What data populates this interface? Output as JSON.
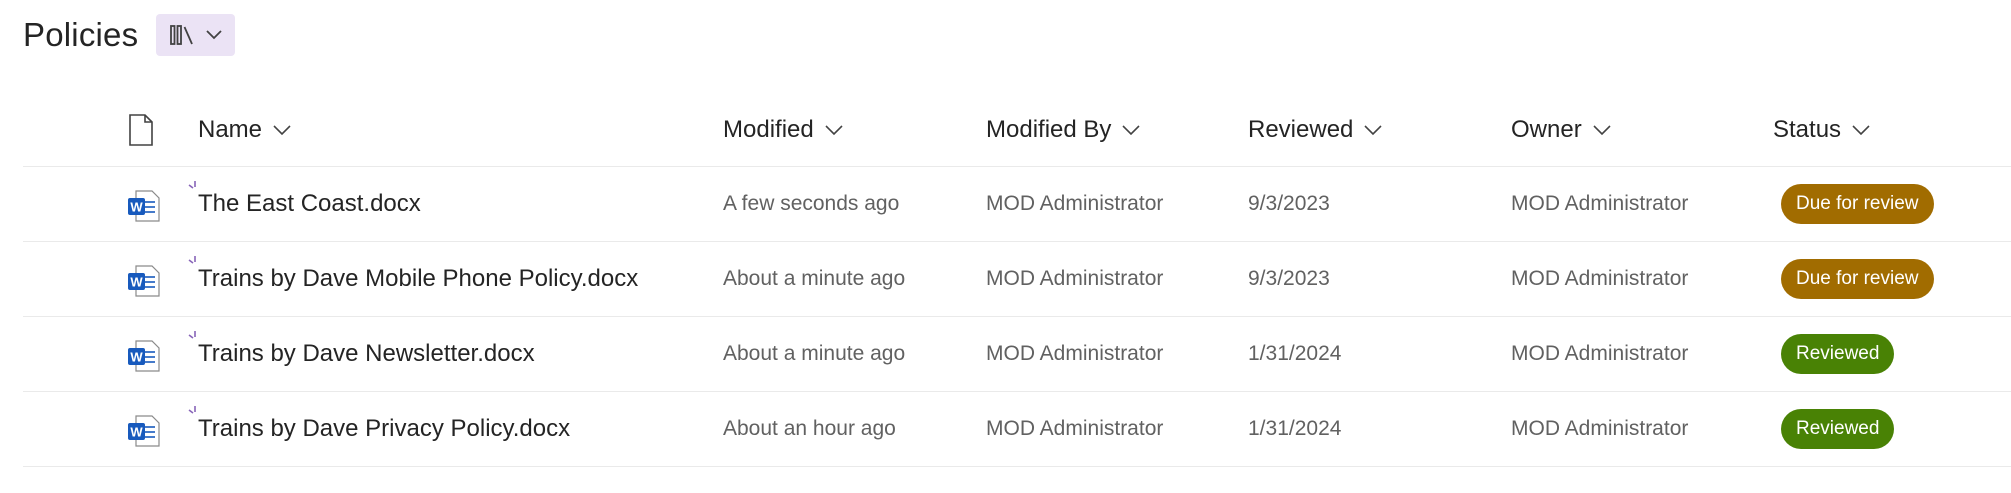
{
  "library": {
    "title": "Policies"
  },
  "columns": {
    "name": "Name",
    "modified": "Modified",
    "modified_by": "Modified By",
    "reviewed": "Reviewed",
    "owner": "Owner",
    "status": "Status"
  },
  "rows": [
    {
      "name": "The East Coast.docx",
      "modified": "A few seconds ago",
      "modified_by": "MOD Administrator",
      "reviewed": "9/3/2023",
      "owner": "MOD Administrator",
      "status": "Due for review"
    },
    {
      "name": "Trains by Dave Mobile Phone Policy.docx",
      "modified": "About a minute ago",
      "modified_by": "MOD Administrator",
      "reviewed": "9/3/2023",
      "owner": "MOD Administrator",
      "status": "Due for review"
    },
    {
      "name": "Trains by Dave Newsletter.docx",
      "modified": "About a minute ago",
      "modified_by": "MOD Administrator",
      "reviewed": "1/31/2024",
      "owner": "MOD Administrator",
      "status": "Reviewed"
    },
    {
      "name": "Trains by Dave Privacy Policy.docx",
      "modified": "About an hour ago",
      "modified_by": "MOD Administrator",
      "reviewed": "1/31/2024",
      "owner": "MOD Administrator",
      "status": "Reviewed"
    }
  ],
  "icons": {
    "view": "library-view-icon",
    "dropdown": "chevron-down-icon",
    "file_type": "document-icon",
    "word": "word-document-icon",
    "new": "new-item-sparkle-icon"
  },
  "colors": {
    "due_for_review": "#a16c00",
    "reviewed": "#498205",
    "view_button_bg": "#ebe3f5",
    "new_mark": "#8764b8",
    "word_blue": "#185abd"
  }
}
